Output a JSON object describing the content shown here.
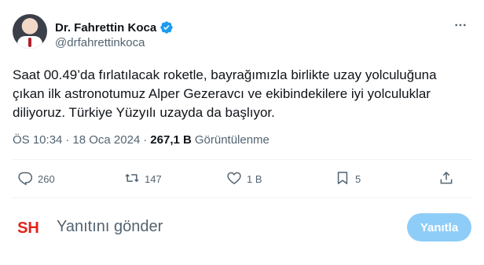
{
  "author": {
    "name": "Dr. Fahrettin Koca",
    "handle": "@drfahrettinkoca",
    "verified_color": "#1d9bf0"
  },
  "tweet": {
    "text": "Saat 00.49’da fırlatılacak roketle, bayrağımızla birlikte uzay yolculuğuna\nçıkan ilk astronotumuz Alper Gezeravcı ve ekibindekilere iyi yolculuklar\ndiliyoruz. Türkiye Yüzyılı uzayda da başlıyor."
  },
  "meta": {
    "time": "ÖS 10:34",
    "date": "18 Oca 2024",
    "views_count": "267,1 B",
    "views_label": "Görüntülenme"
  },
  "actions": {
    "reply_count": "260",
    "retweet_count": "147",
    "like_count": "1 B",
    "bookmark_count": "5"
  },
  "reply": {
    "avatar_text": "SH",
    "placeholder": "Yanıtını gönder",
    "button_label": "Yanıtla"
  },
  "colors": {
    "text": "#0f1419",
    "muted": "#536471",
    "accent": "#1d9bf0",
    "reply_button": "#8ecdf8",
    "brand_red": "#e2231a"
  }
}
